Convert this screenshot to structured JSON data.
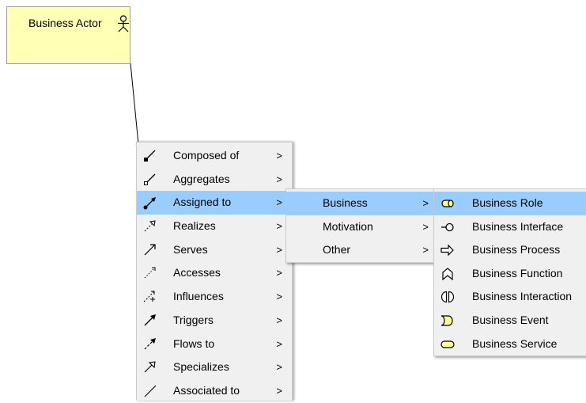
{
  "diagram": {
    "actor": {
      "label": "Business Actor",
      "icon": "stick-figure-icon"
    }
  },
  "menus": {
    "relations": {
      "items": [
        {
          "label": "Composed of",
          "arrow": ">",
          "icon": "composition-icon"
        },
        {
          "label": "Aggregates",
          "arrow": ">",
          "icon": "aggregation-icon"
        },
        {
          "label": "Assigned to",
          "arrow": ">",
          "icon": "assignment-icon"
        },
        {
          "label": "Realizes",
          "arrow": ">",
          "icon": "realization-icon"
        },
        {
          "label": "Serves",
          "arrow": ">",
          "icon": "serving-icon"
        },
        {
          "label": "Accesses",
          "arrow": ">",
          "icon": "access-icon"
        },
        {
          "label": "Influences",
          "arrow": ">",
          "icon": "influence-icon"
        },
        {
          "label": "Triggers",
          "arrow": ">",
          "icon": "triggering-icon"
        },
        {
          "label": "Flows to",
          "arrow": ">",
          "icon": "flow-icon"
        },
        {
          "label": "Specializes",
          "arrow": ">",
          "icon": "specialization-icon"
        },
        {
          "label": "Associated to",
          "arrow": ">",
          "icon": "association-icon"
        }
      ],
      "highlighted": "Assigned to"
    },
    "categories": {
      "items": [
        {
          "label": "Business",
          "arrow": ">"
        },
        {
          "label": "Motivation",
          "arrow": ">"
        },
        {
          "label": "Other",
          "arrow": ">"
        }
      ],
      "highlighted": "Business"
    },
    "elements": {
      "items": [
        {
          "label": "Business Role",
          "icon": "business-role-icon"
        },
        {
          "label": "Business Interface",
          "icon": "business-interface-icon"
        },
        {
          "label": "Business Process",
          "icon": "business-process-icon"
        },
        {
          "label": "Business Function",
          "icon": "business-function-icon"
        },
        {
          "label": "Business Interaction",
          "icon": "business-interaction-icon"
        },
        {
          "label": "Business Event",
          "icon": "business-event-icon"
        },
        {
          "label": "Business Service",
          "icon": "business-service-icon"
        }
      ],
      "highlighted": "Business Role"
    }
  },
  "colors": {
    "actor_fill": "#ffffb5",
    "menu_bg": "#f0f0f0",
    "highlight": "#99ccff"
  }
}
